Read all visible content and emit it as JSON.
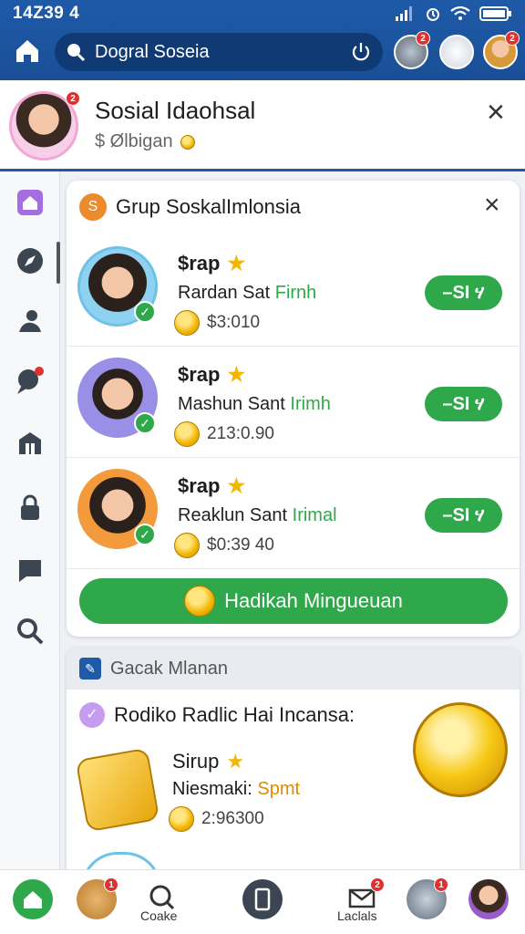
{
  "status_bar": {
    "time": "14Z39 4"
  },
  "search": {
    "placeholder": "Dogral Soseia"
  },
  "profile": {
    "name": "Sosial Idaohsal",
    "subtitle": "$ Ølbigan"
  },
  "group_card": {
    "title": "Grup SoskalImlonsia",
    "rows": [
      {
        "label": "$rap",
        "sub_prefix": "Rardan Sat ",
        "sub_highlight": "Firnh",
        "amount": "$3:010",
        "action": "–SI ሃ"
      },
      {
        "label": "$rap",
        "sub_prefix": "Mashun Sant ",
        "sub_highlight": "Irimh",
        "amount": "213:0.90",
        "action": "–SI ሃ"
      },
      {
        "label": "$rap",
        "sub_prefix": "Reaklun Sant ",
        "sub_highlight": "Irimal",
        "amount": "$0:39 40",
        "action": "–SI ሃ"
      }
    ],
    "primary_button": "Hadikah Mingueuan"
  },
  "section2": {
    "header": "Gacak Mlanan",
    "subtitle": "Rodiko Radlic Hai Incansa:",
    "item": {
      "label": "Sirup",
      "line_prefix": "Niesmaki: ",
      "line_highlight": "Spmt",
      "amount": "2:96300"
    }
  },
  "bottom_nav": {
    "search_label": "Coake",
    "mail_label": "Laclals"
  },
  "colors": {
    "primary_blue": "#1e5aa8",
    "action_green": "#2ea84a",
    "badge_red": "#e03131",
    "coin_gold": "#f2b705"
  }
}
